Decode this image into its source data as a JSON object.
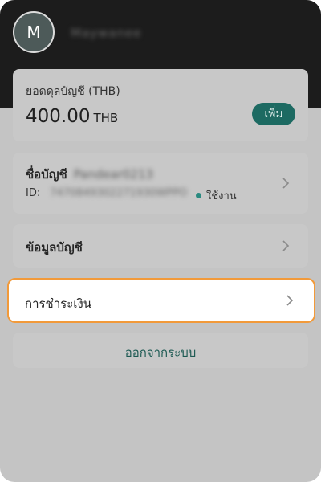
{
  "header": {
    "avatar_initial": "M",
    "username": "Maywanee"
  },
  "balance": {
    "label": "ยอดดุลบัญชี (THB)",
    "value": "400.00",
    "currency": "THB",
    "add_label": "เพิ่ม"
  },
  "account": {
    "name_label": "ชื่อบัญชี",
    "name_value": "Pandear0213",
    "id_label": "ID:",
    "id_value": "7470849302271930WPPO",
    "status": "ใช้งาน"
  },
  "menu": {
    "info_label": "ข้อมูลบัญชี",
    "payment_label": "การชำระเงิน",
    "logout_label": "ออกจากระบบ"
  },
  "colors": {
    "accent": "#1d6a62",
    "highlight_border": "#f29a3a",
    "header_bg": "#1c1c1c",
    "overlay_bg": "#c4c4c4"
  },
  "icons": {
    "chevron": "chevron-right-icon",
    "status": "status-dot-icon"
  }
}
